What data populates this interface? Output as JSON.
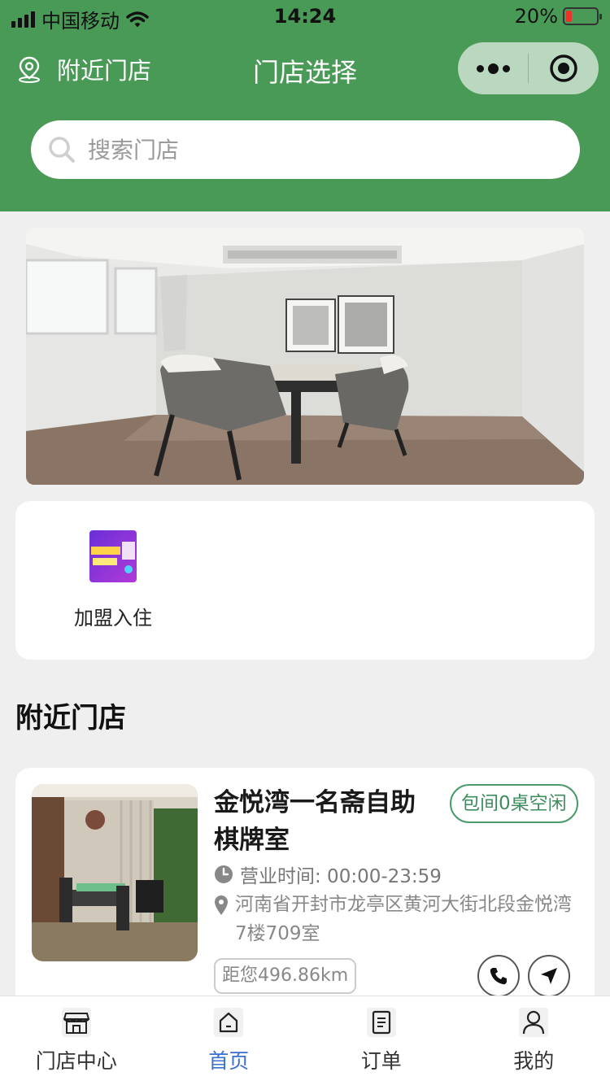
{
  "status_bar": {
    "carrier": "中国移动",
    "time": "14:24",
    "battery": "20%",
    "battery_level": 0.2
  },
  "nav": {
    "location_label": "附近门店",
    "title": "门店选择"
  },
  "search": {
    "placeholder": "搜索门店"
  },
  "services": [
    {
      "label": "加盟入住",
      "icon": "franchise-icon"
    }
  ],
  "section_title": "附近门店",
  "store": {
    "name": "金悦湾一名斋自助棋牌室",
    "badge": "包间0桌空闲",
    "hours": "营业时间: 00:00-23:59",
    "address": "河南省开封市龙亭区黄河大街北段金悦湾7楼709室",
    "distance": "距您496.86km"
  },
  "tabbar": [
    {
      "label": "门店中心",
      "icon": "store-icon",
      "active": false
    },
    {
      "label": "首页",
      "icon": "home-icon",
      "active": true
    },
    {
      "label": "订单",
      "icon": "order-icon",
      "active": false
    },
    {
      "label": "我的",
      "icon": "user-icon",
      "active": false
    }
  ],
  "colors": {
    "header": "#4a9a57",
    "badge": "#3f8d5f",
    "tab_active": "#3a6fd0",
    "battery": "#e8322a"
  }
}
